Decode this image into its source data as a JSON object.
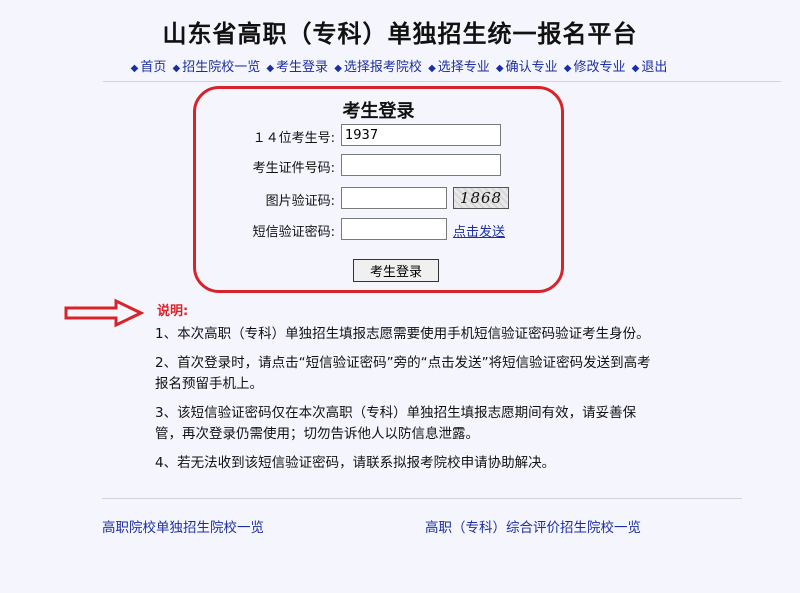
{
  "header": {
    "title": "山东省高职（专科）单独招生统一报名平台"
  },
  "nav": {
    "items": [
      "首页",
      "招生院校一览",
      "考生登录",
      "选择报考院校",
      "选择专业",
      "确认专业",
      "修改专业",
      "退出"
    ]
  },
  "login": {
    "title": "考生登录",
    "id_label": "１４位考生号:",
    "id_value": "1937",
    "cert_label": "考生证件号码:",
    "cert_value": "",
    "captcha_label": "图片验证码:",
    "captcha_value": "",
    "captcha_image_text": "1868",
    "sms_label": "短信验证密码:",
    "sms_value": "",
    "sms_link": "点击发送",
    "submit": "考生登录"
  },
  "notes": {
    "title": "说明:",
    "items": [
      "1、本次高职（专科）单独招生填报志愿需要使用手机短信验证密码验证考生身份。",
      "2、首次登录时，请点击“短信验证密码”旁的“点击发送”将短信验证密码发送到高考报名预留手机上。",
      "3、该短信验证密码仅在本次高职（专科）单独招生填报志愿期间有效，请妥善保管，再次登录仍需使用；切勿告诉他人以防信息泄露。",
      "4、若无法收到该短信验证密码，请联系拟报考院校申请协助解决。"
    ]
  },
  "footer": {
    "link_left": "高职院校单独招生院校一览",
    "link_right": "高职（专科）综合评价招生院校一览"
  },
  "colors": {
    "accent_red": "#d8232a",
    "link_blue": "#1d2fa0",
    "background": "#f5f6fd"
  }
}
